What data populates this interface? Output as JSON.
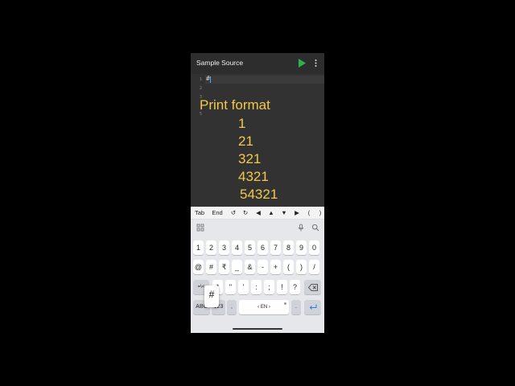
{
  "appbar": {
    "title": "Sample Source",
    "run_color": "#2bb24c"
  },
  "editor": {
    "line_numbers": [
      "1",
      "2",
      "3",
      "5"
    ],
    "code_line1": "#"
  },
  "overlay": {
    "title": "Print format",
    "lines": [
      "1",
      "21",
      "321",
      "4321",
      "54321"
    ],
    "color": "#f2c94c"
  },
  "extra_keys": [
    "Tab",
    "End",
    "↺",
    "↻",
    "◀",
    "▲",
    "▼",
    "▶",
    "(",
    ")"
  ],
  "keyboard": {
    "popup": "#",
    "row_numbers": [
      "1",
      "2",
      "3",
      "4",
      "5",
      "6",
      "7",
      "8",
      "9",
      "0"
    ],
    "row_symbols1": [
      "@",
      "#",
      "₹",
      "_",
      "&",
      "-",
      "+",
      "(",
      ")",
      "/"
    ],
    "row_symbols2": [
      "=\\<",
      "*",
      "\"",
      "'",
      ":",
      ";",
      "!",
      "?"
    ],
    "row_bottom": {
      "abc": "ABC",
      "num": "123",
      "comma": ",",
      "space": "‹ EN ›",
      "period": "."
    }
  }
}
